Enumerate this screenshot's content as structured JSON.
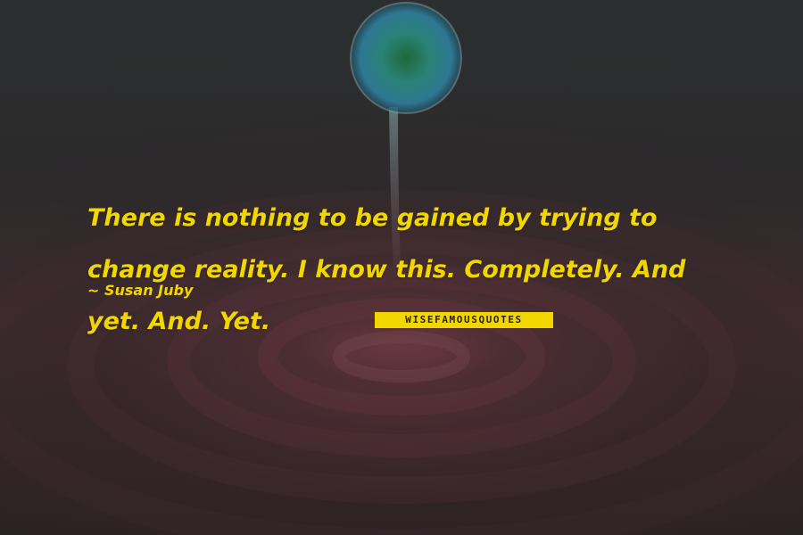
{
  "quote": {
    "text": "There is nothing to be gained by trying to change reality. I know this. Completely. And yet. And. Yet.",
    "author": "~ Susan Juby"
  },
  "watermark": {
    "logo_text": "WISEFAMOUSQUOTES"
  },
  "colors": {
    "text": "#f2d600",
    "background": "#2a2324",
    "ripple": "#6e3a42",
    "droplet": "#2c8f8a"
  }
}
